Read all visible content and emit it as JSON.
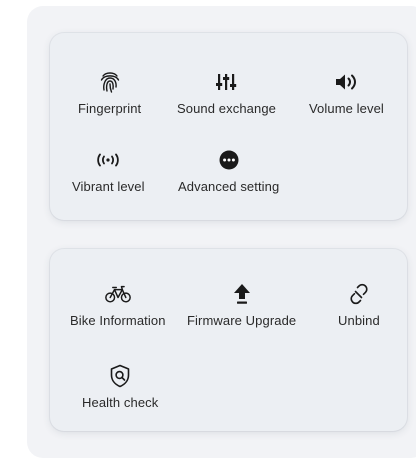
{
  "settings": {
    "section1": {
      "items": [
        {
          "label": "Fingerprint",
          "icon": "fingerprint-icon"
        },
        {
          "label": "Sound exchange",
          "icon": "equalizer-sliders-icon"
        },
        {
          "label": "Volume level",
          "icon": "speaker-volume-icon"
        },
        {
          "label": "Vibrant level",
          "icon": "vibration-icon"
        },
        {
          "label": "Advanced setting",
          "icon": "more-dots-icon"
        }
      ]
    },
    "section2": {
      "items": [
        {
          "label": "Bike Information",
          "icon": "bicycle-icon"
        },
        {
          "label": "Firmware Upgrade",
          "icon": "upload-arrow-icon"
        },
        {
          "label": "Unbind",
          "icon": "unlink-icon"
        },
        {
          "label": "Health check",
          "icon": "shield-search-icon"
        }
      ]
    }
  },
  "colors": {
    "panel_bg": "#f2f3f6",
    "card_bg": "#eceff3",
    "icon": "#1a1a1a",
    "text": "#2a2a2a"
  }
}
